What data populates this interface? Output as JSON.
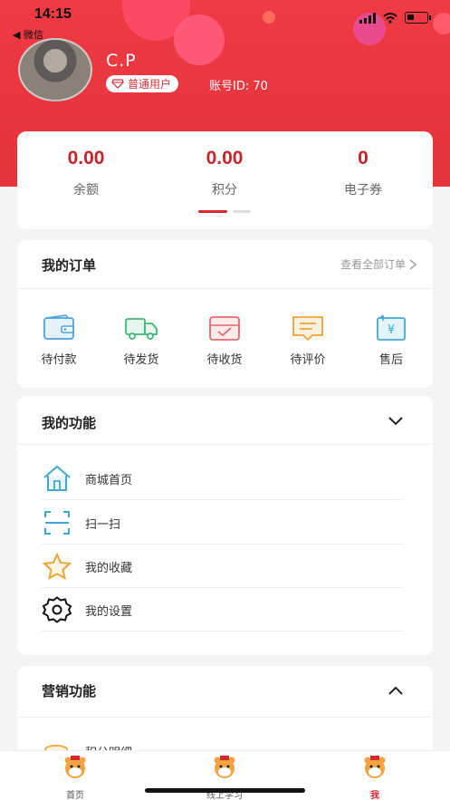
{
  "status_bar": {
    "time": "14:15",
    "back_app": "◀ 微信"
  },
  "profile": {
    "username": "C.P",
    "badge": "普通用户",
    "account_id": "账号ID: 70"
  },
  "stats": [
    {
      "value": "0.00",
      "label": "余额"
    },
    {
      "value": "0.00",
      "label": "积分"
    },
    {
      "value": "0",
      "label": "电子券"
    }
  ],
  "orders": {
    "title": "我的订单",
    "view_all": "查看全部订单",
    "items": [
      {
        "label": "待付款",
        "icon": "wallet-icon"
      },
      {
        "label": "待发货",
        "icon": "truck-icon"
      },
      {
        "label": "待收货",
        "icon": "inbox-icon"
      },
      {
        "label": "待评价",
        "icon": "comment-icon"
      },
      {
        "label": "售后",
        "icon": "refund-icon"
      }
    ]
  },
  "functions": {
    "title": "我的功能",
    "items": [
      {
        "label": "商城首页",
        "icon": "home-icon"
      },
      {
        "label": "扫一扫",
        "icon": "scan-icon"
      },
      {
        "label": "我的收藏",
        "icon": "star-icon"
      },
      {
        "label": "我的设置",
        "icon": "gear-icon"
      }
    ]
  },
  "marketing": {
    "title": "营销功能",
    "items": [
      {
        "label": "积分明细",
        "icon": "coins-icon"
      }
    ]
  },
  "tabbar": [
    {
      "label": "首页",
      "active": false
    },
    {
      "label": "线上学习",
      "active": false
    },
    {
      "label": "我",
      "active": true
    }
  ],
  "colors": {
    "brand": "#e4333a",
    "accent_text": "#c6232b"
  }
}
